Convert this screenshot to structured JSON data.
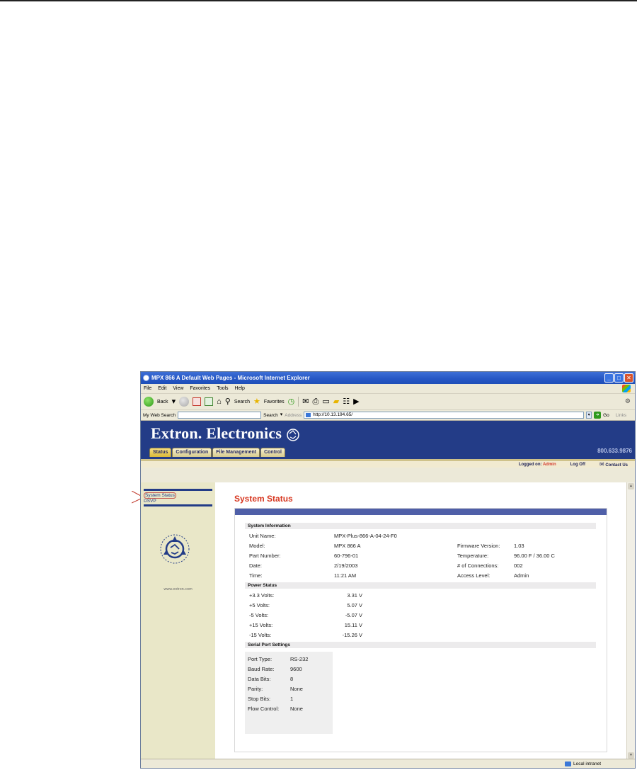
{
  "window": {
    "title": "MPX 866 A Default Web Pages - Microsoft Internet Explorer",
    "controls": [
      "_",
      "□",
      "✕"
    ]
  },
  "menu": [
    "File",
    "Edit",
    "View",
    "Favorites",
    "Tools",
    "Help"
  ],
  "toolbar": {
    "back_label": "Back",
    "search_label": "Search",
    "favorites_label": "Favorites"
  },
  "addressbar": {
    "web_search_label": "My Web Search",
    "search_button": "Search",
    "address_label": "Address",
    "url": "http://10.13.194.65/",
    "go_label": "Go",
    "links_label": "Links"
  },
  "banner": {
    "brand": "Extron. Electronics",
    "phone": "800.633.9876",
    "tabs": [
      "Status",
      "Configuration",
      "File Management",
      "Control"
    ],
    "active_tab": "Status"
  },
  "subbar": {
    "logged_on_label": "Logged on:",
    "user": "Admin",
    "logoff": "Log Off",
    "contact": "Contact Us"
  },
  "sidebar": {
    "links": [
      "System Status",
      "DSVP"
    ],
    "url": "www.extron.com"
  },
  "main": {
    "title": "System Status",
    "system_info": {
      "heading": "System Information",
      "left": [
        {
          "label": "Unit Name:",
          "value": "MPX-Plus-866-A-04-24-F0"
        },
        {
          "label": "Model:",
          "value": "MPX 866 A"
        },
        {
          "label": "Part Number:",
          "value": "60-796-01"
        },
        {
          "label": "Date:",
          "value": "2/19/2003"
        },
        {
          "label": "Time:",
          "value": "11:21 AM"
        }
      ],
      "right": [
        {
          "label": "Firmware Version:",
          "value": "1.03"
        },
        {
          "label": "Temperature:",
          "value": "96.00 F / 36.00 C"
        },
        {
          "label": "# of Connections:",
          "value": "002"
        },
        {
          "label": "Access Level:",
          "value": "Admin"
        }
      ]
    },
    "power_status": {
      "heading": "Power Status",
      "rows": [
        {
          "label": "+3.3 Volts:",
          "value": "3.31 V"
        },
        {
          "label": "+5 Volts:",
          "value": "5.07 V"
        },
        {
          "label": "-5 Volts:",
          "value": "-5.07 V"
        },
        {
          "label": "+15 Volts:",
          "value": "15.11 V"
        },
        {
          "label": "-15 Volts:",
          "value": "-15.26 V"
        }
      ]
    },
    "serial_port": {
      "heading": "Serial Port Settings",
      "rows": [
        {
          "label": "Port Type:",
          "value": "RS-232"
        },
        {
          "label": "Baud Rate:",
          "value": "9600"
        },
        {
          "label": "Data Bits:",
          "value": "8"
        },
        {
          "label": "Parity:",
          "value": "None"
        },
        {
          "label": "Stop Bits:",
          "value": "1"
        },
        {
          "label": "Flow Control:",
          "value": "None"
        }
      ]
    }
  },
  "statusbar": {
    "zone": "Local intranet"
  },
  "colors": {
    "banner_blue": "#233c87",
    "title_red": "#d7361f",
    "panel_header": "#4f5fa8",
    "sidebar_bg": "#e9e7c8"
  }
}
